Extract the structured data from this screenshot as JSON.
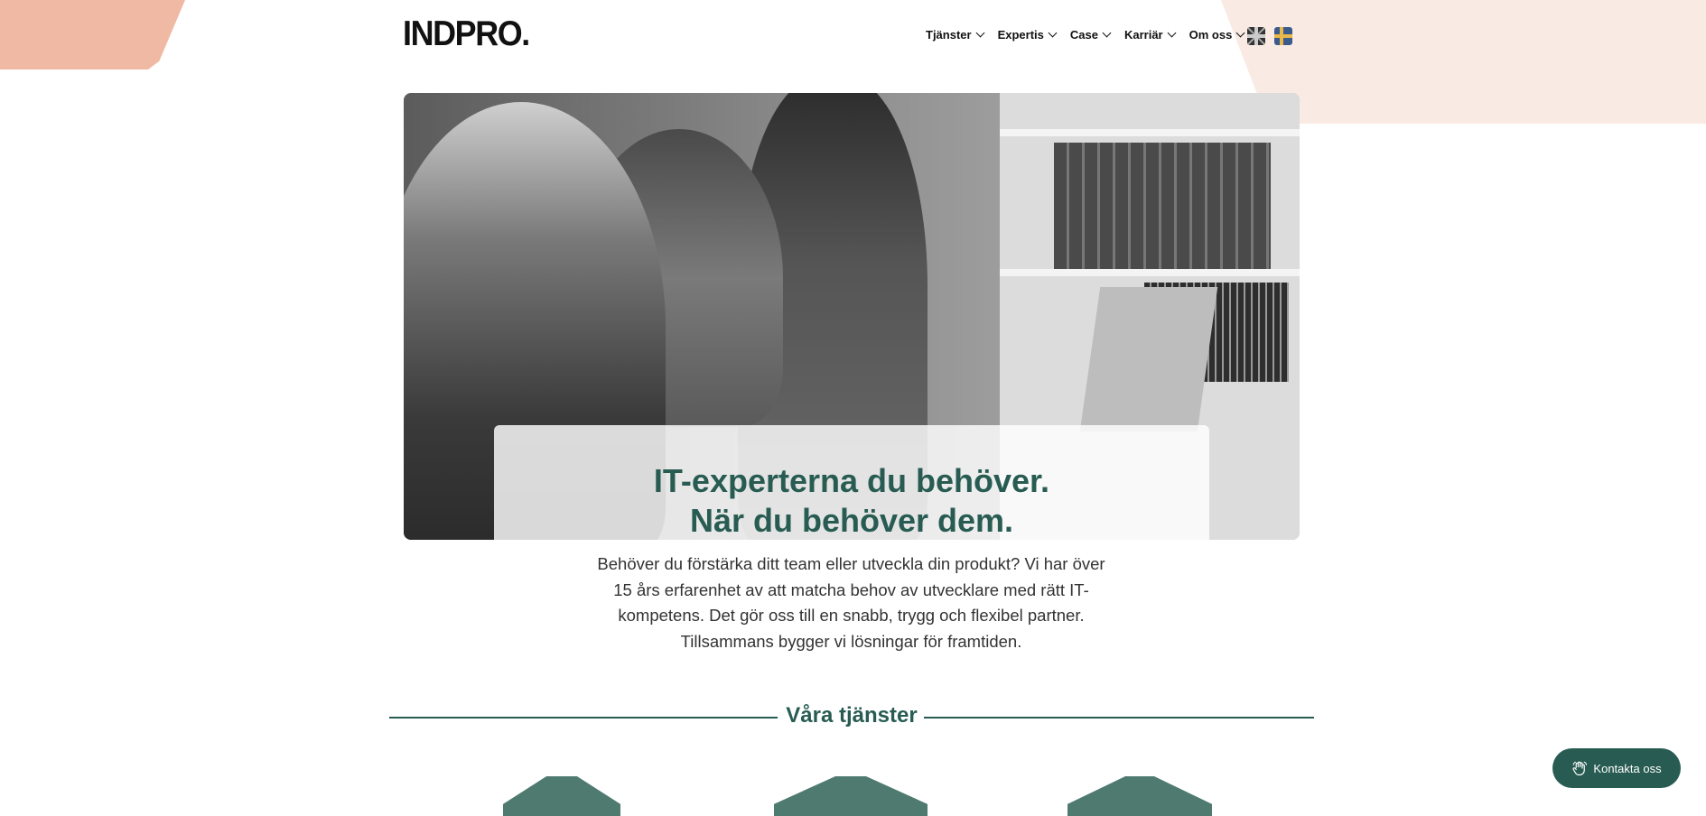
{
  "brand": {
    "logo_text": "INDPRO."
  },
  "nav": {
    "items": [
      {
        "label": "Tjänster"
      },
      {
        "label": "Expertis"
      },
      {
        "label": "Case"
      },
      {
        "label": "Karriär"
      },
      {
        "label": "Om oss"
      }
    ],
    "languages": [
      {
        "icon": "uk-flag-icon"
      },
      {
        "icon": "sweden-flag-icon"
      }
    ]
  },
  "hero": {
    "title_line1": "IT-experterna du behöver.",
    "title_line2": "När du behöver dem.",
    "intro_line1": "Behöver du förstärka ditt team eller utveckla din produkt? Vi har över",
    "intro_line2": "15 års erfarenhet av att matcha behov av utvecklare med rätt IT-",
    "intro_line3": "kompetens. Det gör oss till en snabb, trygg och flexibel partner.",
    "intro_line4": "Tillsammans bygger vi lösningar för framtiden."
  },
  "services": {
    "heading": "Våra tjänster"
  },
  "contact": {
    "label": "Kontakta oss",
    "icon": "waving-hand-icon"
  },
  "colors": {
    "brand_green": "#285c52",
    "peach": "#efb9a3",
    "light_peach": "#faeae4"
  }
}
